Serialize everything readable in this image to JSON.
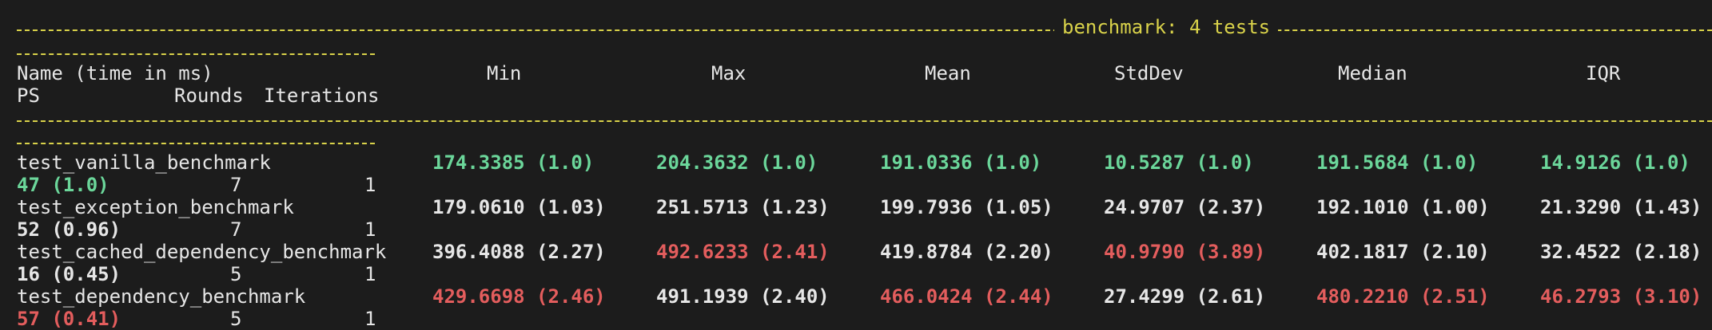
{
  "title": "benchmark: 4 tests",
  "headers": {
    "name": "Name (time in ms)",
    "ps": "PS",
    "rounds": "Rounds",
    "iterations": "Iterations",
    "min": "Min",
    "max": "Max",
    "mean": "Mean",
    "stddev": "StdDev",
    "median": "Median",
    "iqr": "IQR"
  },
  "rows": [
    {
      "name": "test_vanilla_benchmark",
      "min": "174.3385 (1.0)",
      "max": "204.3632 (1.0)",
      "mean": "191.0336 (1.0)",
      "stddev": "10.5287 (1.0)",
      "median": "191.5684 (1.0)",
      "iqr": "14.9126 (1.0)",
      "ps": "47 (1.0)",
      "rounds": "7",
      "iterations": "1"
    },
    {
      "name": "test_exception_benchmark",
      "min": "179.0610 (1.03)",
      "max": "251.5713 (1.23)",
      "mean": "199.7936 (1.05)",
      "stddev": "24.9707 (2.37)",
      "median": "192.1010 (1.00)",
      "iqr": "21.3290 (1.43)",
      "ps": "52 (0.96)",
      "rounds": "7",
      "iterations": "1"
    },
    {
      "name": "test_cached_dependency_benchmark",
      "min": "396.4088 (2.27)",
      "max": "492.6233 (2.41)",
      "mean": "419.8784 (2.20)",
      "stddev": "40.9790 (3.89)",
      "median": "402.1817 (2.10)",
      "iqr": "32.4522 (2.18)",
      "ps": "16 (0.45)",
      "rounds": "5",
      "iterations": "1"
    },
    {
      "name": "test_dependency_benchmark",
      "min": "429.6698 (2.46)",
      "max": "491.1939 (2.40)",
      "mean": "466.0424 (2.44)",
      "stddev": "27.4299 (2.61)",
      "median": "480.2210 (2.51)",
      "iqr": "46.2793 (3.10)",
      "ps": "57 (0.41)",
      "rounds": "5",
      "iterations": "1"
    }
  ],
  "colors": {
    "background": "#1c1c1c",
    "separator": "#d9d24a",
    "best": "#6bd69a",
    "worst": "#e35d5d",
    "text": "#e6e6e6"
  },
  "cell_status": [
    {
      "min": "green",
      "max": "green",
      "mean": "green",
      "stddev": "green",
      "median": "green",
      "iqr": "green",
      "ps": "green"
    },
    {
      "min": "white",
      "max": "white",
      "mean": "white",
      "stddev": "white",
      "median": "white",
      "iqr": "white",
      "ps": "white"
    },
    {
      "min": "white",
      "max": "red",
      "mean": "white",
      "stddev": "red",
      "median": "white",
      "iqr": "white",
      "ps": "white"
    },
    {
      "min": "red",
      "max": "white",
      "mean": "red",
      "stddev": "white",
      "median": "red",
      "iqr": "red",
      "ps": "red"
    }
  ]
}
